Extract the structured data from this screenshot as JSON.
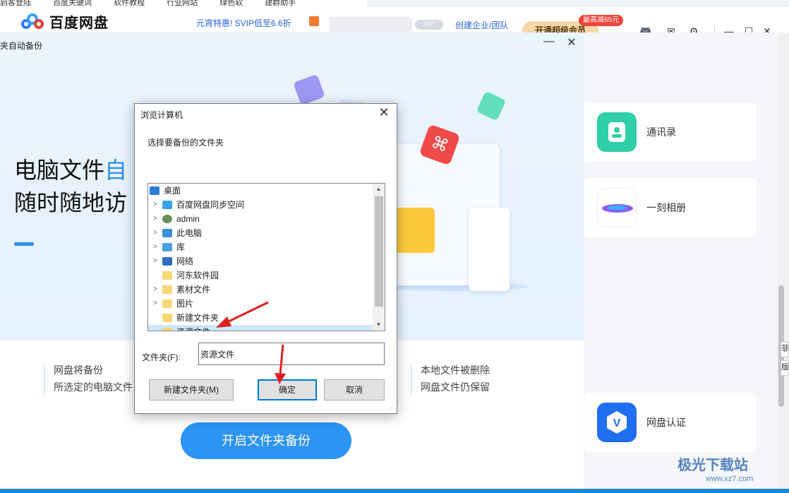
{
  "bookmarks": [
    "启客登陆",
    "百度关键词",
    "软件教程",
    "行业网站",
    "绿色软",
    "建群助手"
  ],
  "app": {
    "name": "百度网盘",
    "promo": "元宵特惠! SVIP低至6.6折",
    "vip_badge": "VIP",
    "enterprise_link": "创建企业/团队",
    "svip_button": "开通超级会员",
    "discount_badge": "最高减65元"
  },
  "panel": {
    "title": "夹自动备份",
    "hero_line1_prefix": "电脑文件",
    "hero_line1_blue": "自",
    "hero_line2": "随时随地访",
    "feature_left_line1": "网盘将备份",
    "feature_left_line2": "所选定的电脑文件",
    "feature_right_line1": "本地文件被删除",
    "feature_right_line2": "网盘文件仍保留",
    "start_button": "开启文件夹备份"
  },
  "right_cards": [
    {
      "label": "通讯录",
      "icon": "contacts-icon",
      "color": "#2fcfa8"
    },
    {
      "label": "一刻相册",
      "icon": "album-icon",
      "color": "#8b5cf6"
    },
    {
      "label": "网盘认证",
      "icon": "verify-icon",
      "color": "#1f6ff2"
    }
  ],
  "side_tabs": [
    "菲",
    "版"
  ],
  "dialog": {
    "title": "浏览计算机",
    "instruction": "选择要备份的文件夹",
    "tree": [
      {
        "label": "桌面",
        "icon": "desktop-icon",
        "expandable": false,
        "indent": 0
      },
      {
        "label": "百度网盘同步空间",
        "icon": "netdisk-sync-icon",
        "expandable": true,
        "indent": 1
      },
      {
        "label": "admin",
        "icon": "user-icon",
        "expandable": true,
        "indent": 1
      },
      {
        "label": "此电脑",
        "icon": "computer-icon",
        "expandable": true,
        "indent": 1
      },
      {
        "label": "库",
        "icon": "library-icon",
        "expandable": true,
        "indent": 1
      },
      {
        "label": "网络",
        "icon": "network-icon",
        "expandable": true,
        "indent": 1
      },
      {
        "label": "河东软件园",
        "icon": "folder-icon",
        "expandable": false,
        "indent": 1
      },
      {
        "label": "素材文件",
        "icon": "folder-icon",
        "expandable": true,
        "indent": 1
      },
      {
        "label": "图片",
        "icon": "folder-icon",
        "expandable": true,
        "indent": 1
      },
      {
        "label": "新建文件夹",
        "icon": "folder-icon",
        "expandable": false,
        "indent": 1
      },
      {
        "label": "资源文件",
        "icon": "folder-icon",
        "expandable": false,
        "indent": 1,
        "selected": true
      }
    ],
    "folder_label": "文件夹(F):",
    "folder_value": "资源文件",
    "new_folder_button": "新建文件夹(M)",
    "ok_button": "确定",
    "cancel_button": "取消"
  },
  "watermark": {
    "text": "极光下载站",
    "url": "www.xz7.com"
  },
  "colors": {
    "accent": "#2c94f4",
    "annotation": "#e02020",
    "dialog_select": "#cce8ff"
  }
}
